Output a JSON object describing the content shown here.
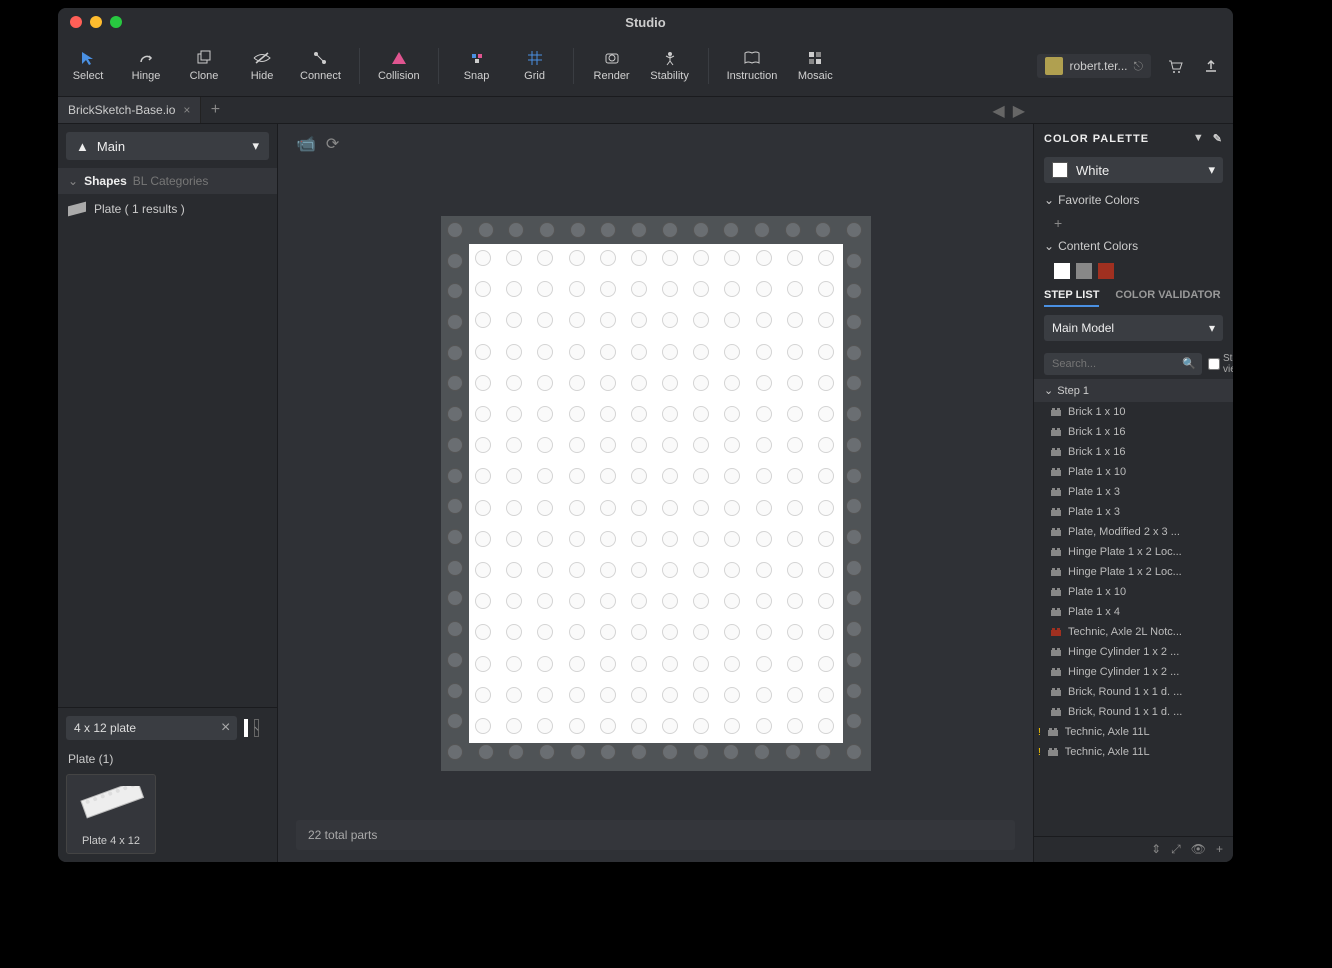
{
  "window": {
    "title": "Studio"
  },
  "toolbar": {
    "items": [
      {
        "id": "select",
        "label": "Select"
      },
      {
        "id": "hinge",
        "label": "Hinge"
      },
      {
        "id": "clone",
        "label": "Clone"
      },
      {
        "id": "hide",
        "label": "Hide"
      },
      {
        "id": "connect",
        "label": "Connect"
      },
      {
        "id": "collision",
        "label": "Collision"
      },
      {
        "id": "snap",
        "label": "Snap"
      },
      {
        "id": "grid",
        "label": "Grid"
      },
      {
        "id": "render",
        "label": "Render"
      },
      {
        "id": "stability",
        "label": "Stability"
      },
      {
        "id": "instruction",
        "label": "Instruction"
      },
      {
        "id": "mosaic",
        "label": "Mosaic"
      }
    ],
    "user": "robert.ter..."
  },
  "filetab": {
    "name": "BrickSketch-Base.io"
  },
  "left": {
    "main_label": "Main",
    "shapes_label": "Shapes",
    "categories_label": "BL Categories",
    "plate_result": "Plate ( 1 results )",
    "search_value": "4 x 12 plate",
    "result_header": "Plate (1)",
    "thumb_label": "Plate 4 x 12"
  },
  "status": {
    "text": "22 total parts"
  },
  "right": {
    "palette_title": "COLOR PALETTE",
    "color_selected": "White",
    "favorite_label": "Favorite Colors",
    "content_label": "Content Colors",
    "content_colors": [
      "#ffffff",
      "#888888",
      "#a03020"
    ],
    "tab_steplist": "STEP LIST",
    "tab_validator": "COLOR VALIDATOR",
    "model_label": "Main Model",
    "search_placeholder": "Search...",
    "stepview_label": "Step view",
    "step_header": "Step 1",
    "steps": [
      {
        "label": "Brick 1 x 10",
        "color": "#888"
      },
      {
        "label": "Brick 1 x 16",
        "color": "#888"
      },
      {
        "label": "Brick 1 x 16",
        "color": "#888"
      },
      {
        "label": "Plate 1 x 10",
        "color": "#888"
      },
      {
        "label": "Plate 1 x 3",
        "color": "#888"
      },
      {
        "label": "Plate 1 x 3",
        "color": "#888"
      },
      {
        "label": "Plate, Modified 2 x 3 ...",
        "color": "#888"
      },
      {
        "label": "Hinge Plate 1 x 2 Loc...",
        "color": "#888"
      },
      {
        "label": "Hinge Plate 1 x 2 Loc...",
        "color": "#888"
      },
      {
        "label": "Plate 1 x 10",
        "color": "#888"
      },
      {
        "label": "Plate 1 x 4",
        "color": "#888"
      },
      {
        "label": "Technic, Axle  2L Notc...",
        "color": "#a03020"
      },
      {
        "label": "Hinge Cylinder 1 x 2 ...",
        "color": "#888"
      },
      {
        "label": "Hinge Cylinder 1 x 2 ...",
        "color": "#888"
      },
      {
        "label": "Brick, Round 1 x 1 d. ...",
        "color": "#888"
      },
      {
        "label": "Brick, Round 1 x 1 d. ...",
        "color": "#888"
      },
      {
        "label": "Technic, Axle 11L",
        "color": "#888",
        "warn": true
      },
      {
        "label": "Technic, Axle 11L",
        "color": "#888",
        "warn": true
      }
    ]
  }
}
